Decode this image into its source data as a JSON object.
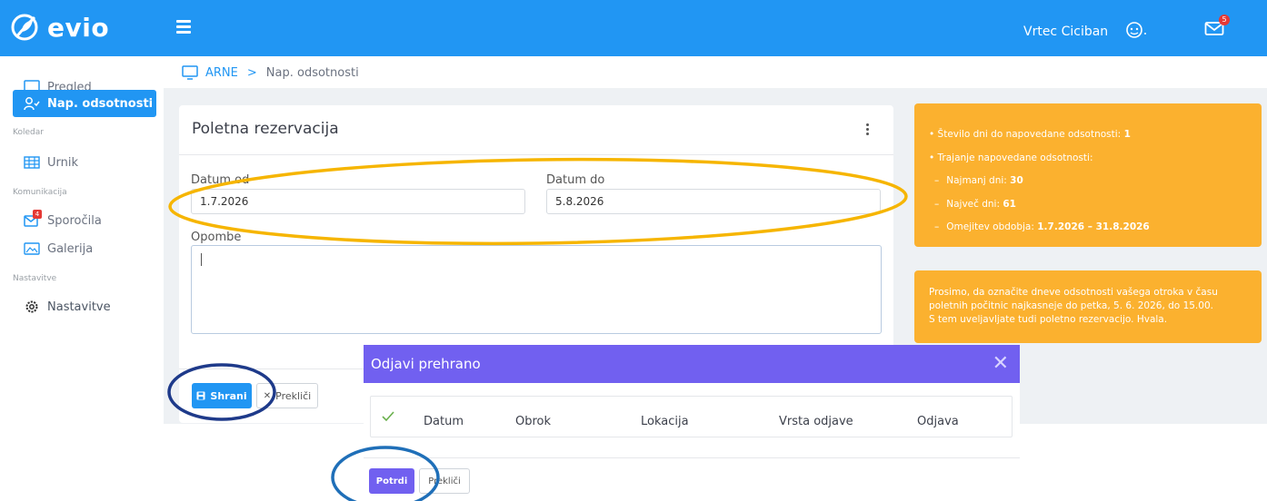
{
  "app": {
    "logo_text": "evio"
  },
  "topbar": {
    "org_name": "Vrtec Ciciban",
    "mail_badge": "5",
    "colors": {
      "primary": "#2196f3"
    }
  },
  "sidebar": {
    "items": [
      {
        "label": "Pregled",
        "icon": "monitor-icon"
      },
      {
        "label": "Nap. odsotnosti",
        "icon": "user-check-icon"
      }
    ],
    "section_koledar": "Koledar",
    "item_urnik": "Urnik",
    "section_komunikacija": "Komunikacija",
    "item_sporocila": "Sporočila",
    "sporocila_badge": "4",
    "item_galerija": "Galerija",
    "section_nastavitve": "Nastavitve",
    "item_nastavitve": "Nastavitve"
  },
  "breadcrumb": {
    "root": "ARNE",
    "separator": ">",
    "current": "Nap. odsotnosti"
  },
  "form": {
    "title": "Poletna rezervacija",
    "date_from_label": "Datum od",
    "date_from_value": "1.7.2026",
    "date_to_label": "Datum do",
    "date_to_value": "5.8.2026",
    "notes_label": "Opombe",
    "notes_value": "",
    "save_label": "Shrani",
    "cancel_label": "Prekliči"
  },
  "info_box": {
    "line1_text": "• Število dni do napovedane odsotnosti: ",
    "line1_value": "1",
    "line2_text": "• Trajanje napovedane odsotnosti:",
    "line3_text": "Najmanj dni: ",
    "line3_value": "30",
    "line4_text": "Največ dni: ",
    "line4_value": "61",
    "line5_text": "Omejitev obdobja: ",
    "line5_value": "1.7.2026 – 31.8.2026",
    "dash": "–",
    "accent_color": "#fbb12f"
  },
  "notice_box": {
    "line1": "Prosimo, da označite dneve odsotnosti vašega otroka v času",
    "line2": "poletnih počitnic najkasneje do petka, 5. 6. 2026, do 15.00.",
    "line3": "S tem uveljavljate tudi poletno rezervacijo. Hvala."
  },
  "modal": {
    "title": "Odjavi prehrano",
    "close_glyph": "✕",
    "columns": [
      "Datum",
      "Obrok",
      "Lokacija",
      "Vrsta odjave",
      "Odjava"
    ],
    "confirm_label": "Potrdi",
    "cancel_label": "Prekliči",
    "accent_color": "#7160f0"
  }
}
